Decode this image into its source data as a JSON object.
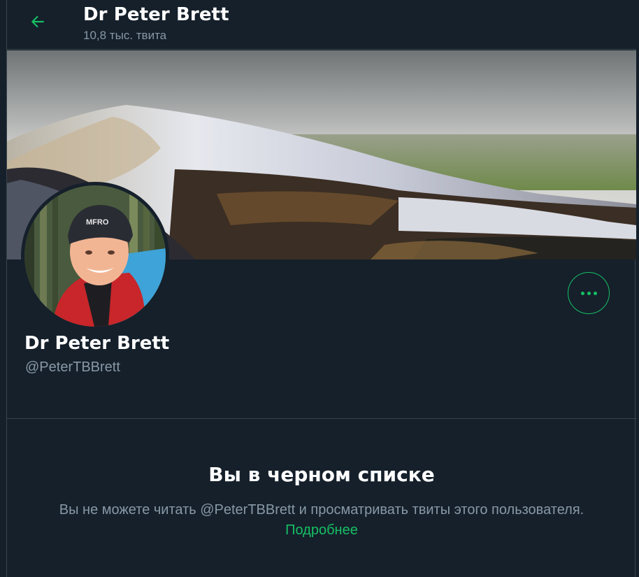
{
  "header": {
    "title": "Dr Peter Brett",
    "tweet_count": "10,8 тыс. твита",
    "back_icon": "arrow-left-icon"
  },
  "profile": {
    "display_name": "Dr Peter Brett",
    "handle": "@PeterTBBrett",
    "more_icon": "more-dots-icon",
    "hat_text": "MFRO"
  },
  "blocked": {
    "title": "Вы в черном списке",
    "message": "Вы не можете читать @PeterTBBrett и просматривать твиты этого пользователя.",
    "learn_more": "Подробнее"
  },
  "colors": {
    "background": "#15202b",
    "border": "#38444d",
    "accent": "#17bf63",
    "secondary_text": "#8899a6"
  }
}
